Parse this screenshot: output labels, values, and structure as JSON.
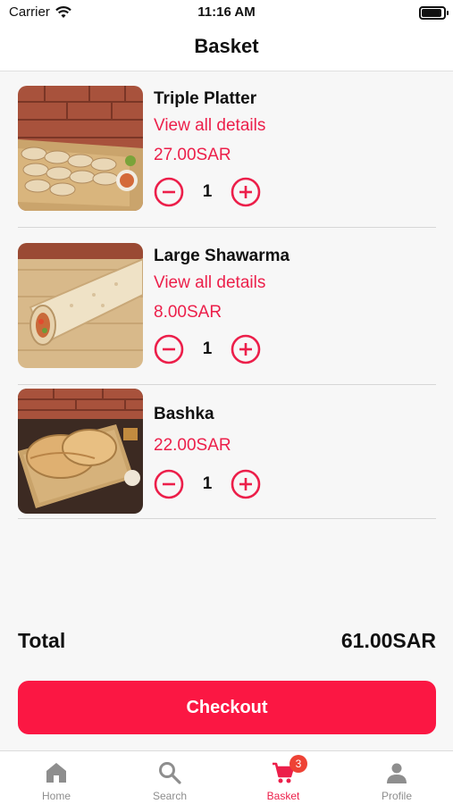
{
  "status_bar": {
    "carrier": "Carrier",
    "time": "11:16 AM"
  },
  "header": {
    "title": "Basket"
  },
  "items": [
    {
      "name": "Triple Platter",
      "details_link": "View all details",
      "price": "27.00SAR",
      "quantity": "1",
      "image": "triple-platter-photo"
    },
    {
      "name": "Large Shawarma",
      "details_link": "View all details",
      "price": "8.00SAR",
      "quantity": "1",
      "image": "large-shawarma-photo"
    },
    {
      "name": "Bashka",
      "price": "22.00SAR",
      "quantity": "1",
      "image": "bashka-photo"
    }
  ],
  "summary": {
    "total_label": "Total",
    "total_value": "61.00SAR"
  },
  "checkout": {
    "label": "Checkout"
  },
  "tabs": [
    {
      "label": "Home",
      "icon": "home-icon",
      "active": false
    },
    {
      "label": "Search",
      "icon": "search-icon",
      "active": false
    },
    {
      "label": "Basket",
      "icon": "cart-icon",
      "active": true,
      "badge": "3"
    },
    {
      "label": "Profile",
      "icon": "profile-icon",
      "active": false
    }
  ],
  "colors": {
    "accent": "#ec1f4a",
    "checkout_bg": "#fb1743",
    "badge_bg": "#ee4235",
    "inactive_tab": "#8e8e8e"
  }
}
